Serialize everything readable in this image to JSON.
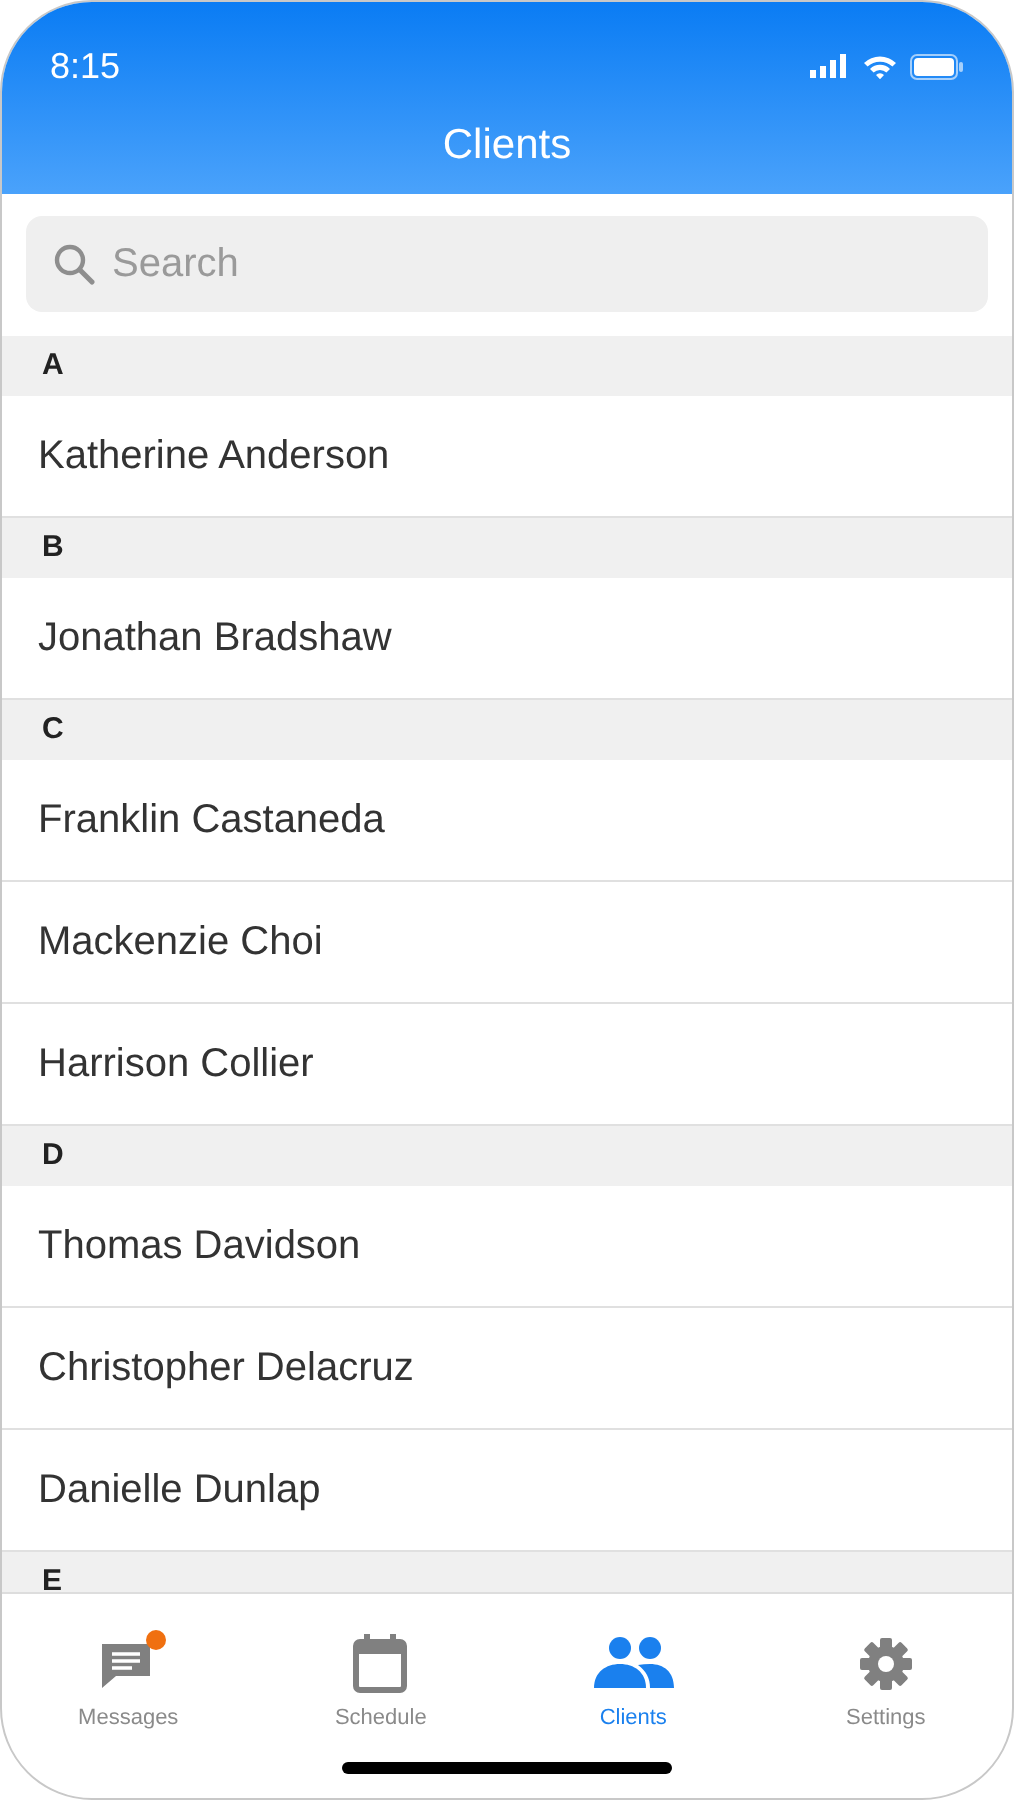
{
  "status_bar": {
    "time": "8:15"
  },
  "header": {
    "title": "Clients"
  },
  "search": {
    "placeholder": "Search"
  },
  "sections": [
    {
      "letter": "A",
      "clients": [
        "Katherine Anderson"
      ]
    },
    {
      "letter": "B",
      "clients": [
        "Jonathan Bradshaw"
      ]
    },
    {
      "letter": "C",
      "clients": [
        "Franklin Castaneda",
        "Mackenzie Choi",
        "Harrison Collier"
      ]
    },
    {
      "letter": "D",
      "clients": [
        "Thomas Davidson",
        "Christopher Delacruz",
        "Danielle Dunlap"
      ]
    },
    {
      "letter": "E"
    }
  ],
  "tabs": [
    {
      "label": "Messages",
      "kind": "messages",
      "selected": false,
      "badge": true
    },
    {
      "label": "Schedule",
      "kind": "schedule",
      "selected": false,
      "badge": false
    },
    {
      "label": "Clients",
      "kind": "clients",
      "selected": true,
      "badge": false
    },
    {
      "label": "Settings",
      "kind": "settings",
      "selected": false,
      "badge": false
    }
  ]
}
